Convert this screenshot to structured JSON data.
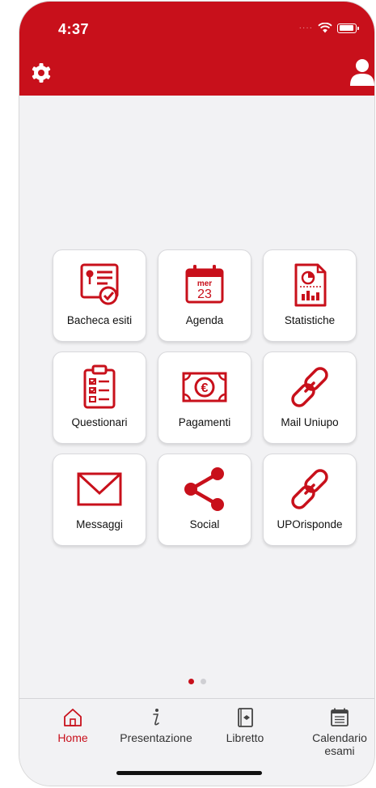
{
  "status": {
    "time": "4:37"
  },
  "colors": {
    "accent": "#c8101b",
    "background": "#f2f2f4",
    "tile": "#ffffff"
  },
  "header": {
    "settings_icon": "gear-icon",
    "profile_icon": "user-icon"
  },
  "tiles": [
    {
      "label": "Bacheca esiti",
      "icon": "bulletin-board-icon"
    },
    {
      "label": "Agenda",
      "icon": "calendar-icon",
      "calendar_day": "mer",
      "calendar_date": "23"
    },
    {
      "label": "Statistiche",
      "icon": "statistics-icon"
    },
    {
      "label": "Questionari",
      "icon": "clipboard-checklist-icon"
    },
    {
      "label": "Pagamenti",
      "icon": "euro-banknote-icon"
    },
    {
      "label": "Mail Uniupo",
      "icon": "link-icon"
    },
    {
      "label": "Messaggi",
      "icon": "envelope-icon"
    },
    {
      "label": "Social",
      "icon": "share-icon"
    },
    {
      "label": "UPOrisponde",
      "icon": "link-icon"
    }
  ],
  "pager": {
    "pages": 2,
    "active": 1
  },
  "tabbar": [
    {
      "label": "Home",
      "icon": "home-icon",
      "active": true
    },
    {
      "label": "Presentazione",
      "icon": "info-icon",
      "active": false
    },
    {
      "label": "Libretto",
      "icon": "booklet-icon",
      "active": false
    },
    {
      "label": "Calendario esami",
      "icon": "exam-calendar-icon",
      "active": false
    }
  ]
}
